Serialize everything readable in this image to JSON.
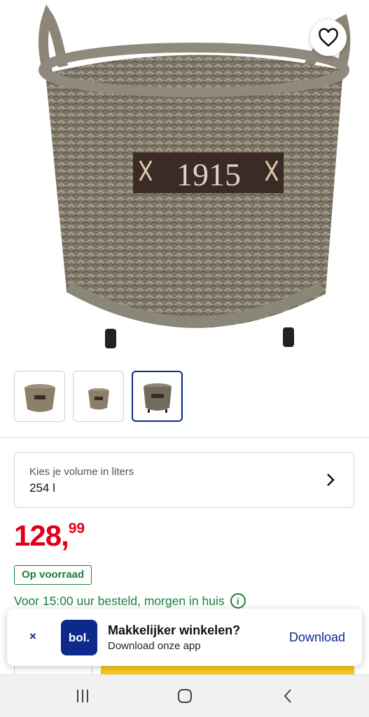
{
  "product": {
    "image_label": "1915",
    "favorite_icon": "heart-outline-icon"
  },
  "thumbnails": [
    {
      "label": "basket-thumb-1",
      "active": false
    },
    {
      "label": "basket-thumb-2",
      "active": false
    },
    {
      "label": "basket-thumb-3",
      "active": true
    }
  ],
  "volume": {
    "label": "Kies je volume in liters",
    "value": "254 l"
  },
  "price": {
    "main": "128,",
    "cents": "99",
    "color": "#e0001a"
  },
  "stock": {
    "badge": "Op voorraad",
    "delivery": "Voor 15:00 uur besteld, morgen in huis",
    "color": "#1a7f3c"
  },
  "app_banner": {
    "close": "×",
    "logo": "bol.",
    "title": "Makkelijker winkelen?",
    "subtitle": "Download onze app",
    "action": "Download",
    "brand_color": "#0b2a8c"
  },
  "system_nav": {
    "recents_icon": "recents-icon",
    "home_icon": "home-icon",
    "back_icon": "back-icon"
  }
}
